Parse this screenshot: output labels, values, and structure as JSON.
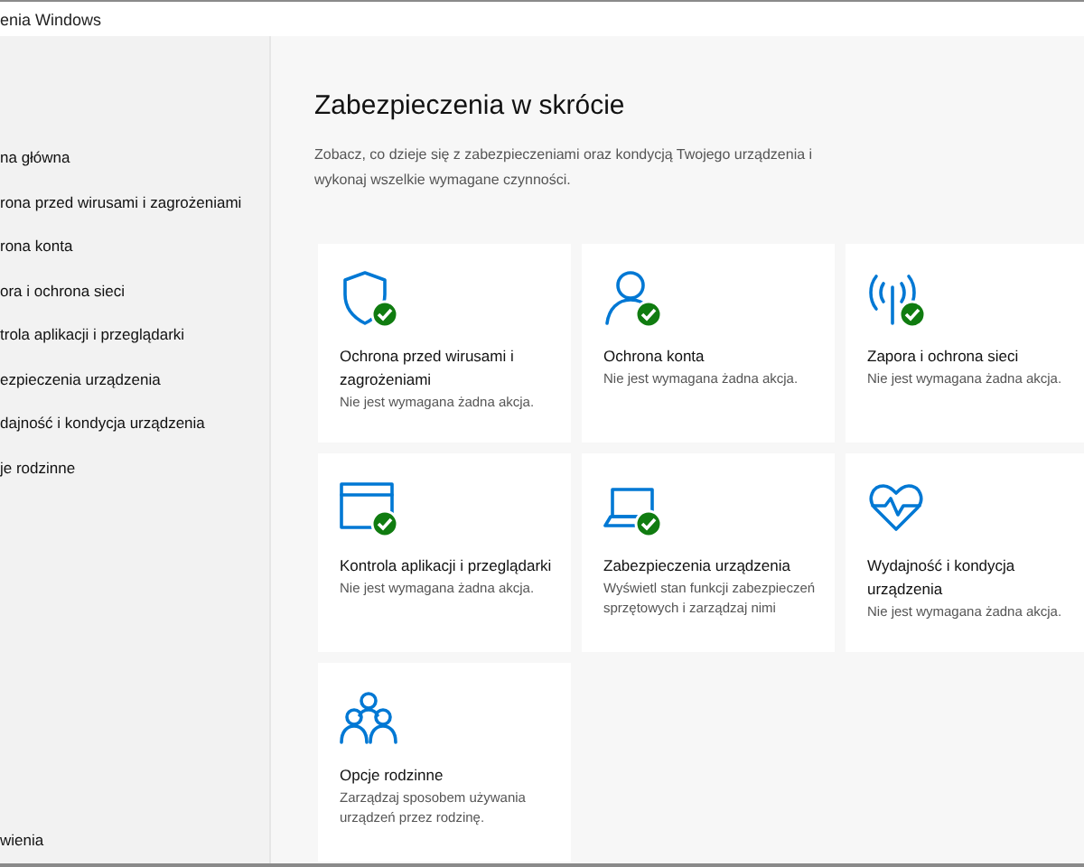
{
  "window": {
    "title": "enia Windows"
  },
  "sidebar": {
    "items": [
      {
        "label": "na główna"
      },
      {
        "label": "rona przed wirusami i zagrożeniami"
      },
      {
        "label": "rona konta"
      },
      {
        "label": "ora i ochrona sieci"
      },
      {
        "label": "trola aplikacji i przeglądarki"
      },
      {
        "label": "ezpieczenia urządzenia"
      },
      {
        "label": "dajność i kondycja urządzenia"
      },
      {
        "label": "je rodzinne"
      }
    ],
    "footer": "wienia"
  },
  "main": {
    "title": "Zabezpieczenia w skrócie",
    "description": "Zobacz, co dzieje się z zabezpieczeniami oraz kondycją Twojego urządzenia i wykonaj wszelkie wymagane czynności.",
    "cards": [
      {
        "ok": true,
        "title": "Ochrona przed wirusami i zagrożeniami",
        "status": "Nie jest wymagana żadna akcja."
      },
      {
        "ok": true,
        "title": "Ochrona konta",
        "status": "Nie jest wymagana żadna akcja."
      },
      {
        "ok": true,
        "title": "Zapora i ochrona sieci",
        "status": "Nie jest wymagana żadna akcja."
      },
      {
        "ok": true,
        "title": "Kontrola aplikacji i przeglądarki",
        "status": "Nie jest wymagana żadna akcja."
      },
      {
        "ok": true,
        "title": "Zabezpieczenia urządzenia",
        "status": "Wyświetl stan funkcji zabezpieczeń sprzętowych i zarządzaj nimi"
      },
      {
        "ok": false,
        "title": "Wydajność i kondycja urządzenia",
        "status": "Nie jest wymagana żadna akcja."
      },
      {
        "ok": false,
        "title": "Opcje rodzinne",
        "status": "Zarządzaj sposobem używania urządzeń przez rodzinę."
      }
    ]
  }
}
